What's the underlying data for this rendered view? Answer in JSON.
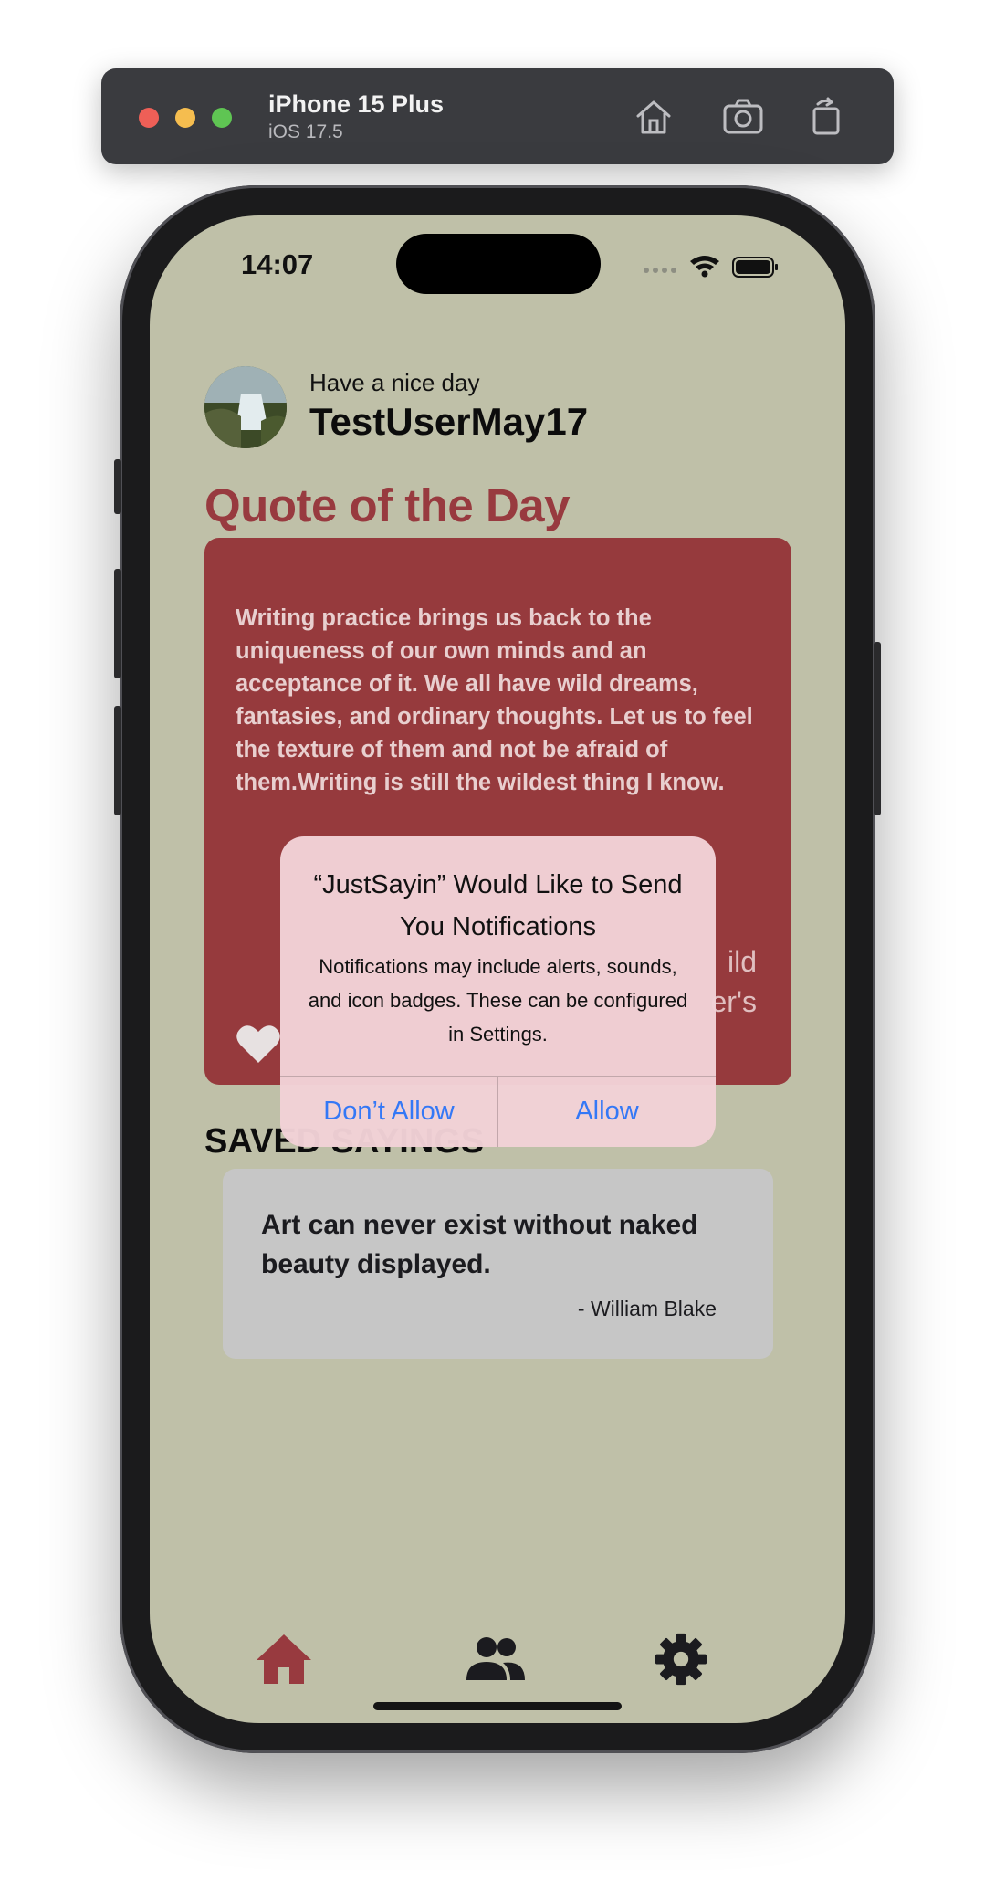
{
  "simulator": {
    "device_name": "iPhone 15 Plus",
    "os_version": "iOS 17.5",
    "icons": [
      "home-icon",
      "screenshot-icon",
      "rotate-icon"
    ]
  },
  "status_bar": {
    "time": "14:07"
  },
  "header": {
    "greeting": "Have a nice day",
    "username": "TestUserMay17"
  },
  "quote_of_day": {
    "title": "Quote of the Day",
    "text": "Writing practice brings us back to the uniqueness of our own minds and an acceptance of it. We all have wild dreams, fantasies, and ordinary thoughts. Let us to feel the texture of them and not be afraid of them.Writing is still the wildest thing I know.",
    "partial_line_1": "ild",
    "partial_line_2": "er's"
  },
  "saved": {
    "title": "SAVED SAYINGS",
    "items": [
      {
        "quote": "Art can never exist without naked beauty displayed.",
        "author": "- William Blake"
      }
    ]
  },
  "alert": {
    "title": "“JustSayin” Would Like to Send You Notifications",
    "message": "Notifications may include alerts, sounds, and icon badges. These can be configured in Settings.",
    "deny_label": "Don’t Allow",
    "allow_label": "Allow"
  },
  "tab_bar": {
    "items": [
      "home-icon",
      "people-icon",
      "gear-icon"
    ],
    "active_color": "#983a3f",
    "inactive_color": "#1b1b1f"
  },
  "colors": {
    "background": "#bfc0a8",
    "accent": "#983a3f",
    "card": "#963a3d",
    "alert_button": "#3478f6"
  }
}
